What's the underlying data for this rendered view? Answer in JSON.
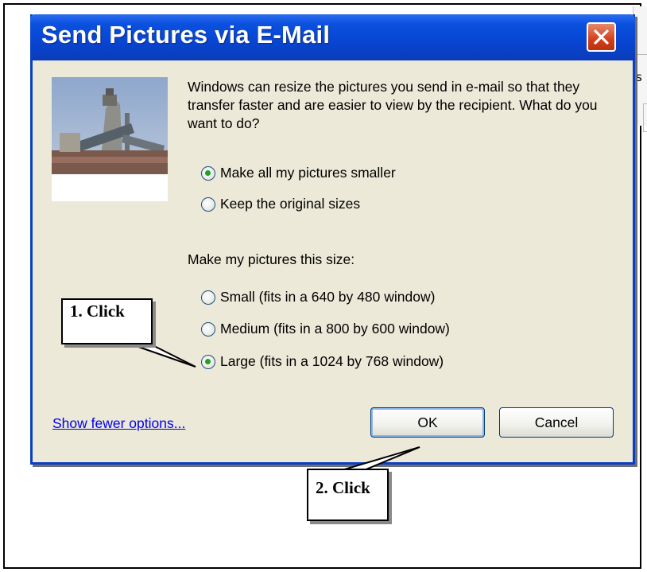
{
  "dialog": {
    "title": "Send Pictures via E-Mail",
    "description": "Windows can resize the pictures you send in e-mail so that they transfer faster and are easier to view by the recipient.  What do you want to do?",
    "options": [
      {
        "label": "Make all my pictures smaller",
        "checked": true
      },
      {
        "label": "Keep the original sizes",
        "checked": false
      }
    ],
    "size_label": "Make my pictures this size:",
    "sizes": [
      {
        "label": "Small (fits in a 640 by 480 window)",
        "checked": false
      },
      {
        "label": "Medium (fits in a 800 by 600 window)",
        "checked": false
      },
      {
        "label": "Large (fits in a 1024 by 768 window)",
        "checked": true
      }
    ],
    "link": "Show fewer options...",
    "ok_label": "OK",
    "cancel_label": "Cancel"
  },
  "background_fragment": "s",
  "callouts": {
    "first": "1. Click",
    "second": "2. Click"
  },
  "colors": {
    "titlebar": "#0a50de",
    "dialog_bg": "#ece9d8",
    "close_button": "#d2401d",
    "radio_dot": "#21a121",
    "link": "#0000ee"
  },
  "icons": {
    "close": "close-icon",
    "thumbnail": "picture-thumbnail"
  }
}
